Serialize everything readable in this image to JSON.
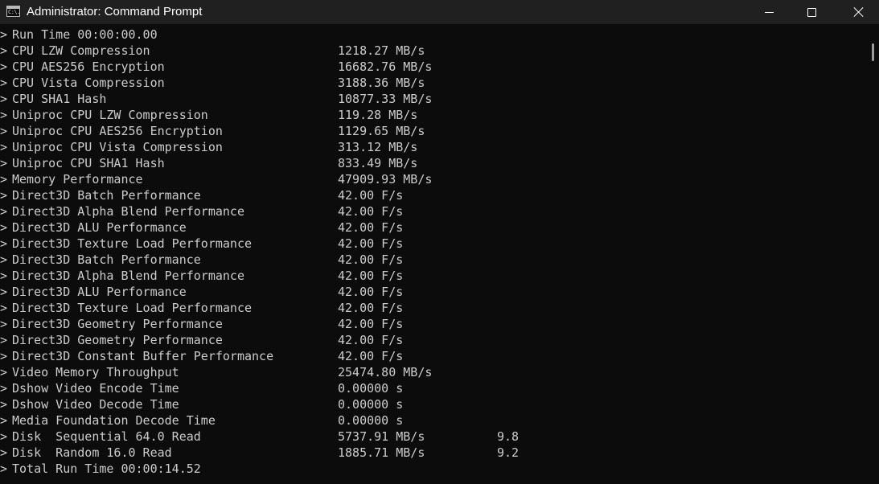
{
  "window": {
    "title": "Administrator: Command Prompt",
    "icon_text": "C:\\.",
    "icons": {
      "app": "command-prompt-icon",
      "minimize": "minimize-icon",
      "maximize": "maximize-icon",
      "close": "close-icon"
    }
  },
  "console": {
    "prompt_symbol": ">",
    "lines": [
      {
        "label": "Run Time 00:00:00.00",
        "value": "",
        "score": ""
      },
      {
        "label": "CPU LZW Compression",
        "value": "1218.27 MB/s",
        "score": ""
      },
      {
        "label": "CPU AES256 Encryption",
        "value": "16682.76 MB/s",
        "score": ""
      },
      {
        "label": "CPU Vista Compression",
        "value": "3188.36 MB/s",
        "score": ""
      },
      {
        "label": "CPU SHA1 Hash",
        "value": "10877.33 MB/s",
        "score": ""
      },
      {
        "label": "Uniproc CPU LZW Compression",
        "value": "119.28 MB/s",
        "score": ""
      },
      {
        "label": "Uniproc CPU AES256 Encryption",
        "value": "1129.65 MB/s",
        "score": ""
      },
      {
        "label": "Uniproc CPU Vista Compression",
        "value": "313.12 MB/s",
        "score": ""
      },
      {
        "label": "Uniproc CPU SHA1 Hash",
        "value": "833.49 MB/s",
        "score": ""
      },
      {
        "label": "Memory Performance",
        "value": "47909.93 MB/s",
        "score": ""
      },
      {
        "label": "Direct3D Batch Performance",
        "value": "42.00 F/s",
        "score": ""
      },
      {
        "label": "Direct3D Alpha Blend Performance",
        "value": "42.00 F/s",
        "score": ""
      },
      {
        "label": "Direct3D ALU Performance",
        "value": "42.00 F/s",
        "score": ""
      },
      {
        "label": "Direct3D Texture Load Performance",
        "value": "42.00 F/s",
        "score": ""
      },
      {
        "label": "Direct3D Batch Performance",
        "value": "42.00 F/s",
        "score": ""
      },
      {
        "label": "Direct3D Alpha Blend Performance",
        "value": "42.00 F/s",
        "score": ""
      },
      {
        "label": "Direct3D ALU Performance",
        "value": "42.00 F/s",
        "score": ""
      },
      {
        "label": "Direct3D Texture Load Performance",
        "value": "42.00 F/s",
        "score": ""
      },
      {
        "label": "Direct3D Geometry Performance",
        "value": "42.00 F/s",
        "score": ""
      },
      {
        "label": "Direct3D Geometry Performance",
        "value": "42.00 F/s",
        "score": ""
      },
      {
        "label": "Direct3D Constant Buffer Performance",
        "value": "42.00 F/s",
        "score": ""
      },
      {
        "label": "Video Memory Throughput",
        "value": "25474.80 MB/s",
        "score": ""
      },
      {
        "label": "Dshow Video Encode Time",
        "value": "0.00000 s",
        "score": ""
      },
      {
        "label": "Dshow Video Decode Time",
        "value": "0.00000 s",
        "score": ""
      },
      {
        "label": "Media Foundation Decode Time",
        "value": "0.00000 s",
        "score": ""
      },
      {
        "label": "Disk  Sequential 64.0 Read",
        "value": "5737.91 MB/s",
        "score": "9.8"
      },
      {
        "label": "Disk  Random 16.0 Read",
        "value": "1885.71 MB/s",
        "score": "9.2"
      },
      {
        "label": "Total Run Time 00:00:14.52",
        "value": "",
        "score": ""
      }
    ]
  },
  "colors": {
    "console_background": "#0c0c0c",
    "console_text": "#cccccc",
    "titlebar_background": "#202020",
    "title_text": "#ffffff"
  }
}
